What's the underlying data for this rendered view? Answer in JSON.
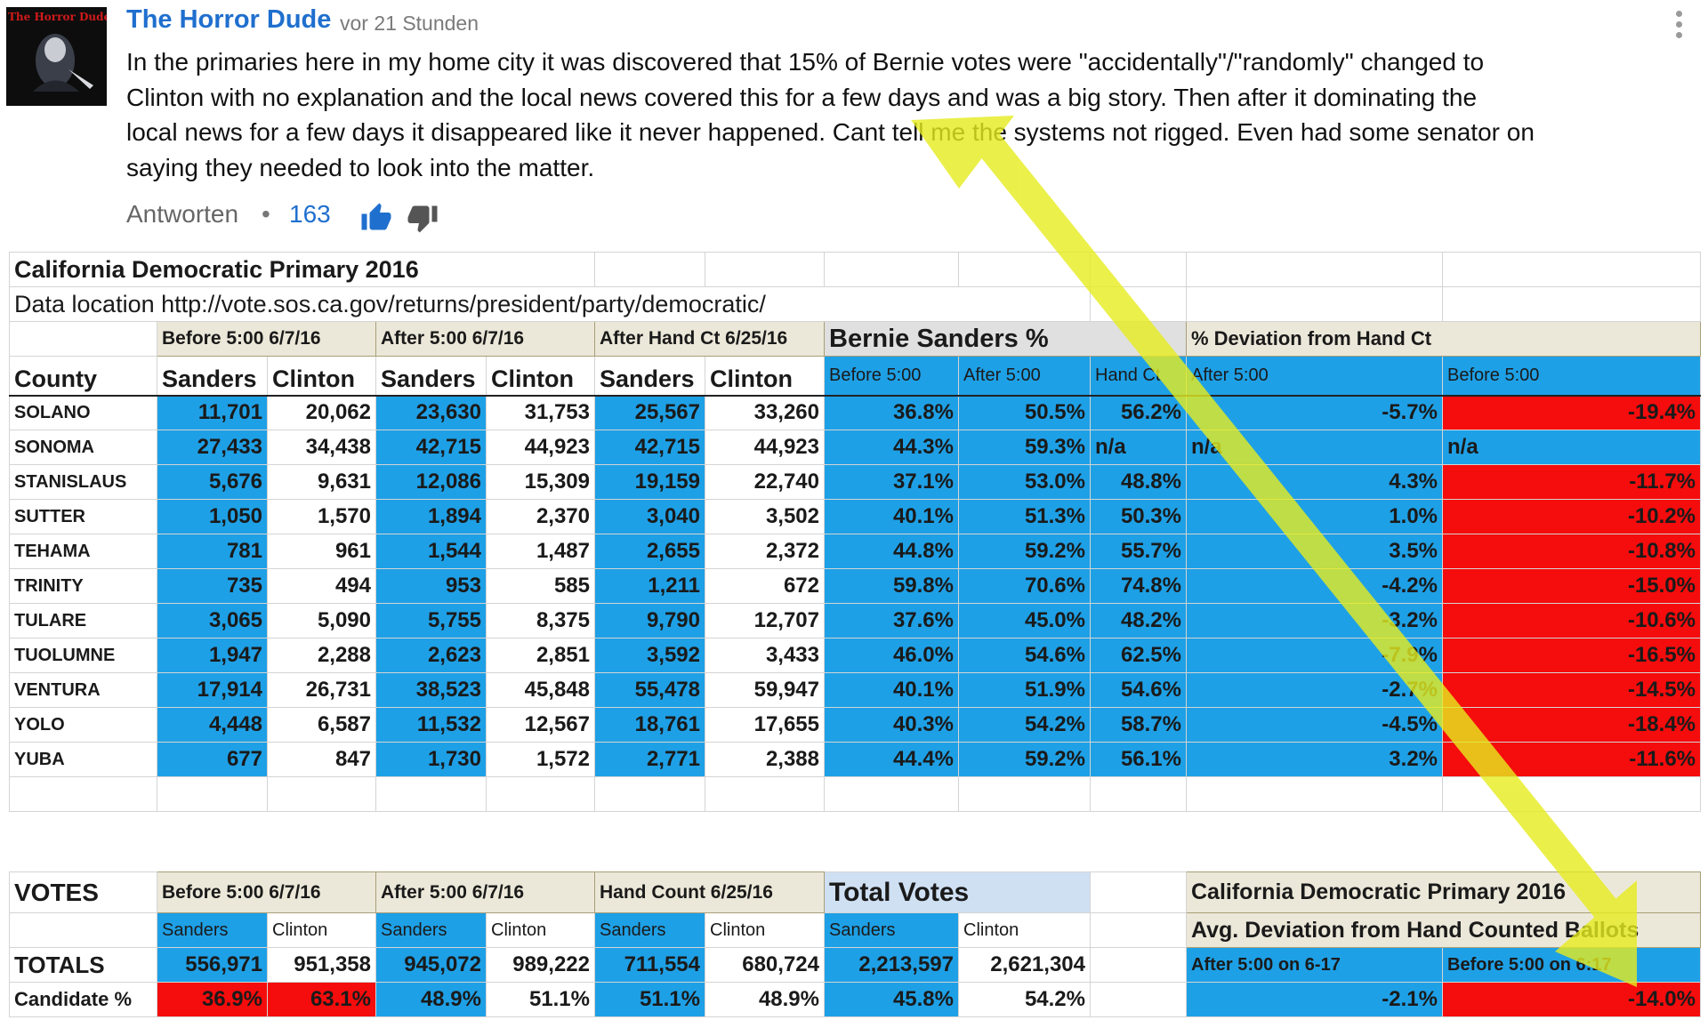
{
  "comment": {
    "author": "The Horror Dude",
    "avatar_text": "The Horror Dude",
    "time_ago": "vor 21 Stunden",
    "lines": [
      "In the primaries here in my home city it was discovered that 15% of Bernie votes were \"accidentally\"/\"randomly\" changed to",
      "Clinton with no explanation and the local news covered this for a few days and was a big story. Then after it dominating the",
      "local news for a few days it disappeared like it never happened. Cant tell me the systems not rigged. Even had some senator on",
      "saying they needed to look into the matter."
    ],
    "reply_label": "Antworten",
    "separator": "•",
    "like_count": "163",
    "like_icon": "thumbs-up-icon",
    "dislike_icon": "thumbs-down-icon",
    "menu_icon": "more-vertical-icon"
  },
  "sheet": {
    "title": "California Democratic Primary 2016",
    "data_location": "Data location http://vote.sos.ca.gov/returns/president/party/democratic/",
    "group_headers": {
      "before": "Before 5:00 6/7/16",
      "after": "After 5:00 6/7/16",
      "hand": "After Hand Ct 6/25/16",
      "bernie_pct": "Bernie Sanders %",
      "deviation": "% Deviation from Hand Ct"
    },
    "col_headers": {
      "county": "County",
      "sanders": "Sanders",
      "clinton": "Clinton",
      "before500": "Before 5:00",
      "after500": "After 5:00",
      "handct": "Hand Ct",
      "dev_after": "After 5:00",
      "dev_before": "Before 5:00"
    },
    "rows": [
      {
        "county": "SOLANO",
        "b_s": "11,701",
        "b_c": "20,062",
        "a_s": "23,630",
        "a_c": "31,753",
        "h_s": "25,567",
        "h_c": "33,260",
        "p_b": "36.8%",
        "p_a": "50.5%",
        "p_h": "56.2%",
        "d_a": "-5.7%",
        "d_b": "-19.4%"
      },
      {
        "county": "SONOMA",
        "b_s": "27,433",
        "b_c": "34,438",
        "a_s": "42,715",
        "a_c": "44,923",
        "h_s": "42,715",
        "h_c": "44,923",
        "p_b": "44.3%",
        "p_a": "59.3%",
        "p_h": "n/a",
        "d_a": "n/a",
        "d_b": "n/a"
      },
      {
        "county": "STANISLAUS",
        "b_s": "5,676",
        "b_c": "9,631",
        "a_s": "12,086",
        "a_c": "15,309",
        "h_s": "19,159",
        "h_c": "22,740",
        "p_b": "37.1%",
        "p_a": "53.0%",
        "p_h": "48.8%",
        "d_a": "4.3%",
        "d_b": "-11.7%"
      },
      {
        "county": "SUTTER",
        "b_s": "1,050",
        "b_c": "1,570",
        "a_s": "1,894",
        "a_c": "2,370",
        "h_s": "3,040",
        "h_c": "3,502",
        "p_b": "40.1%",
        "p_a": "51.3%",
        "p_h": "50.3%",
        "d_a": "1.0%",
        "d_b": "-10.2%"
      },
      {
        "county": "TEHAMA",
        "b_s": "781",
        "b_c": "961",
        "a_s": "1,544",
        "a_c": "1,487",
        "h_s": "2,655",
        "h_c": "2,372",
        "p_b": "44.8%",
        "p_a": "59.2%",
        "p_h": "55.7%",
        "d_a": "3.5%",
        "d_b": "-10.8%"
      },
      {
        "county": "TRINITY",
        "b_s": "735",
        "b_c": "494",
        "a_s": "953",
        "a_c": "585",
        "h_s": "1,211",
        "h_c": "672",
        "p_b": "59.8%",
        "p_a": "70.6%",
        "p_h": "74.8%",
        "d_a": "-4.2%",
        "d_b": "-15.0%"
      },
      {
        "county": "TULARE",
        "b_s": "3,065",
        "b_c": "5,090",
        "a_s": "5,755",
        "a_c": "8,375",
        "h_s": "9,790",
        "h_c": "12,707",
        "p_b": "37.6%",
        "p_a": "45.0%",
        "p_h": "48.2%",
        "d_a": "-3.2%",
        "d_b": "-10.6%"
      },
      {
        "county": "TUOLUMNE",
        "b_s": "1,947",
        "b_c": "2,288",
        "a_s": "2,623",
        "a_c": "2,851",
        "h_s": "3,592",
        "h_c": "3,433",
        "p_b": "46.0%",
        "p_a": "54.6%",
        "p_h": "62.5%",
        "d_a": "-7.9%",
        "d_b": "-16.5%"
      },
      {
        "county": "VENTURA",
        "b_s": "17,914",
        "b_c": "26,731",
        "a_s": "38,523",
        "a_c": "45,848",
        "h_s": "55,478",
        "h_c": "59,947",
        "p_b": "40.1%",
        "p_a": "51.9%",
        "p_h": "54.6%",
        "d_a": "-2.7%",
        "d_b": "-14.5%"
      },
      {
        "county": "YOLO",
        "b_s": "4,448",
        "b_c": "6,587",
        "a_s": "11,532",
        "a_c": "12,567",
        "h_s": "18,761",
        "h_c": "17,655",
        "p_b": "40.3%",
        "p_a": "54.2%",
        "p_h": "58.7%",
        "d_a": "-4.5%",
        "d_b": "-18.4%"
      },
      {
        "county": "YUBA",
        "b_s": "677",
        "b_c": "847",
        "a_s": "1,730",
        "a_c": "1,572",
        "h_s": "2,771",
        "h_c": "2,388",
        "p_b": "44.4%",
        "p_a": "59.2%",
        "p_h": "56.1%",
        "d_a": "3.2%",
        "d_b": "-11.6%"
      }
    ],
    "votes": {
      "label": "VOTES",
      "before": "Before 5:00 6/7/16",
      "after": "After 5:00 6/7/16",
      "hand": "Hand Count 6/25/16",
      "total": "Total Votes",
      "sanders": "Sanders",
      "clinton": "Clinton",
      "totals_label": "TOTALS",
      "totals": [
        "556,971",
        "951,358",
        "945,072",
        "989,222",
        "711,554",
        "680,724",
        "2,213,597",
        "2,621,304"
      ],
      "pct_label": "Candidate %",
      "pct": [
        "36.9%",
        "63.1%",
        "48.9%",
        "51.1%",
        "51.1%",
        "48.9%",
        "45.8%",
        "54.2%"
      ]
    },
    "summary": {
      "title": "California Democratic Primary 2016",
      "subtitle": "Avg. Deviation from Hand Counted Ballots",
      "after_label": "After 5:00 on 6-17",
      "before_label": "Before 5:00 on 6:17",
      "after_value": "-2.1%",
      "before_value": "-14.0%"
    }
  },
  "colors": {
    "link_blue": "#1f6fce",
    "cell_blue": "#1ea0e6",
    "cell_red": "#f50c0c",
    "arrow_yellow": "#e6ec1e"
  }
}
